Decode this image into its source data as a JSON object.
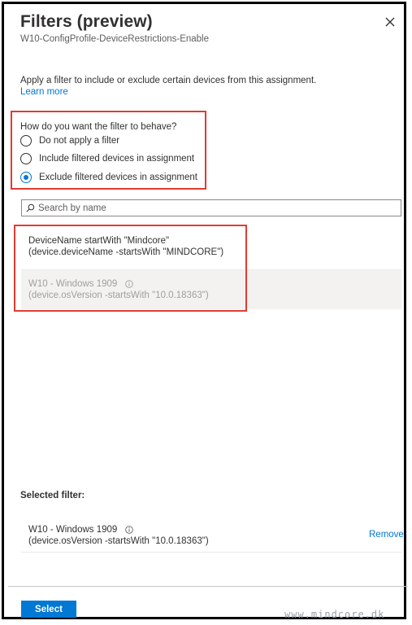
{
  "panel": {
    "title": "Filters (preview)",
    "subtitle": "W10-ConfigProfile-DeviceRestrictions-Enable",
    "close_icon": "close-icon"
  },
  "intro": {
    "description": "Apply a filter to include or exclude certain devices from this assignment.",
    "learn_more": "Learn more"
  },
  "behavior": {
    "question": "How do you want the filter to behave?",
    "options": [
      {
        "label": "Do not apply a filter",
        "selected": false
      },
      {
        "label": "Include filtered devices in assignment",
        "selected": false
      },
      {
        "label": "Exclude filtered devices in assignment",
        "selected": true
      }
    ]
  },
  "search": {
    "placeholder": "Search by name",
    "icon": "search-icon"
  },
  "filters": [
    {
      "name": "DeviceName startWith \"Mindcore\"",
      "rule": "(device.deviceName -startsWith \"MINDCORE\")",
      "disabled": false
    },
    {
      "name": "W10 - Windows 1909",
      "rule": "(device.osVersion -startsWith \"10.0.18363\")",
      "disabled": true,
      "icon": "info-icon"
    }
  ],
  "selected": {
    "label": "Selected filter:",
    "name": "W10 - Windows 1909",
    "rule": "(device.osVersion -startsWith \"10.0.18363\")",
    "icon": "info-icon",
    "remove_label": "Remove"
  },
  "footer": {
    "select_label": "Select"
  },
  "watermark": "www.mindcore.dk",
  "colors": {
    "accent": "#0078d4",
    "highlight_box": "#e03c31",
    "disabled_bg": "#f3f2f1",
    "disabled_text": "#a19f9d"
  }
}
